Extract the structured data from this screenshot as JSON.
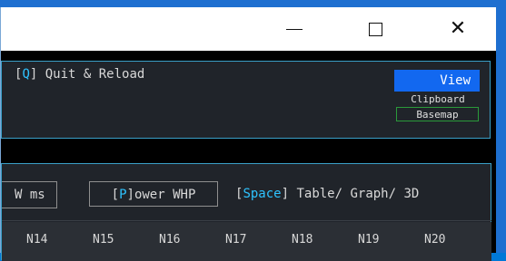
{
  "window": {
    "controls": {
      "minimize": "minimize-icon",
      "maximize": "maximize-icon",
      "close": "close-icon",
      "close_glyph": "✕"
    }
  },
  "top_panel": {
    "quit_key": "Q",
    "quit_label": " Quit & Reload",
    "view_label": "View",
    "clipboard_label": "Clipboard",
    "basemap_label": "Basemap"
  },
  "toolbar": {
    "wms_label": "W ms",
    "power_key": "P",
    "power_label": "ower WHP",
    "space_key": "Space",
    "space_label": " Table/ Graph/ 3D"
  },
  "columns": [
    "N14",
    "N15",
    "N16",
    "N17",
    "N18",
    "N19",
    "N20"
  ],
  "colors": {
    "accent_blue": "#1268f0",
    "key_cyan": "#2ec3ff",
    "panel_border": "#3aa0c8",
    "basemap_border": "#2a9a3a"
  }
}
